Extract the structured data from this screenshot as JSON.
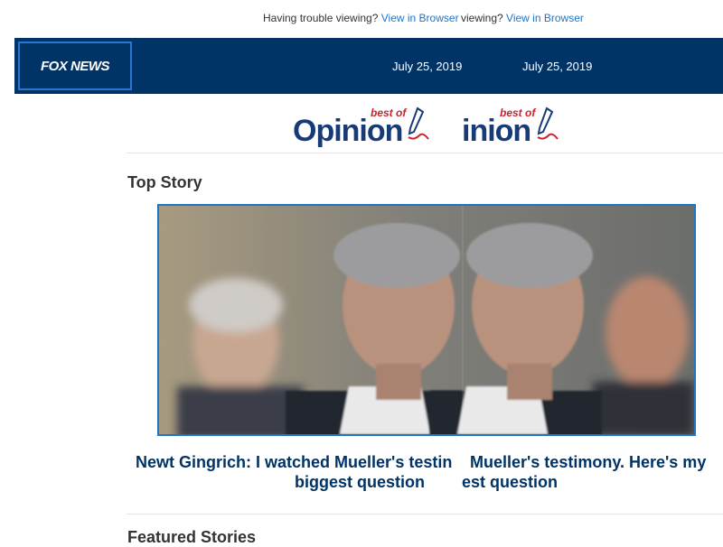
{
  "preheader": {
    "left_text": "Having trouble viewing?",
    "left_link": "View in Browser",
    "right_text": "viewing?",
    "right_link": "View in Browser"
  },
  "header": {
    "logo": "FOX NEWS",
    "date_left": "July 25, 2019",
    "date_right": "July 25, 2019"
  },
  "banner": {
    "word_left": "Opinion",
    "word_right": "inion",
    "tag": "best of"
  },
  "top_story": {
    "section_title": "Top Story",
    "headline_left_line1": "Newt Gingrich: I watched Mueller's testin",
    "headline_left_line2": "biggest question",
    "headline_right_line1": "Mueller's testimony. Here's my",
    "headline_right_line2": "est question"
  },
  "featured": {
    "section_title": "Featured Stories"
  },
  "colors": {
    "navy": "#003366",
    "link_blue": "#1f74c6",
    "opinion_blue": "#183b78",
    "accent_red": "#c9232d"
  }
}
